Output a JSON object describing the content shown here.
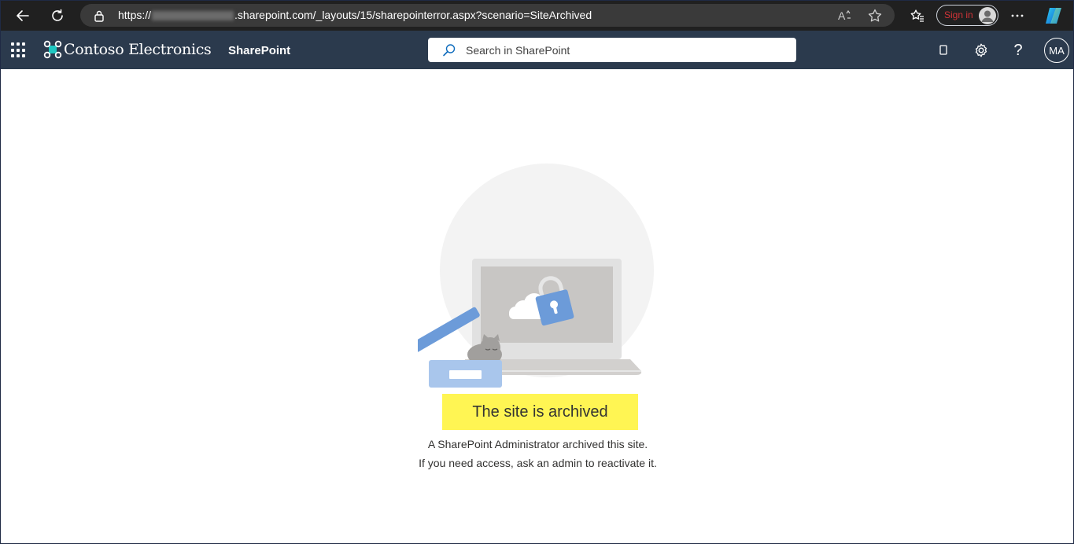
{
  "browser": {
    "url_prefix": "https://",
    "url_suffix": ".sharepoint.com/_layouts/15/sharepointerror.aspx?scenario=SiteArchived",
    "signin_label": "Sign in",
    "read_aloud_label": "Aᴀ"
  },
  "header": {
    "brand": "Contoso Electronics",
    "app_name": "SharePoint",
    "search_placeholder": "Search in SharePoint",
    "help_label": "?",
    "avatar_initials": "MA"
  },
  "main": {
    "title": "The site is archived",
    "line1": "A SharePoint Administrator archived this site.",
    "line2": "If you need access, ask an admin to reactivate it."
  },
  "colors": {
    "browser_bg": "#202020",
    "header_bg": "#2b3a4d",
    "highlight": "#fff553",
    "accent_blue": "#6c9bd9"
  }
}
